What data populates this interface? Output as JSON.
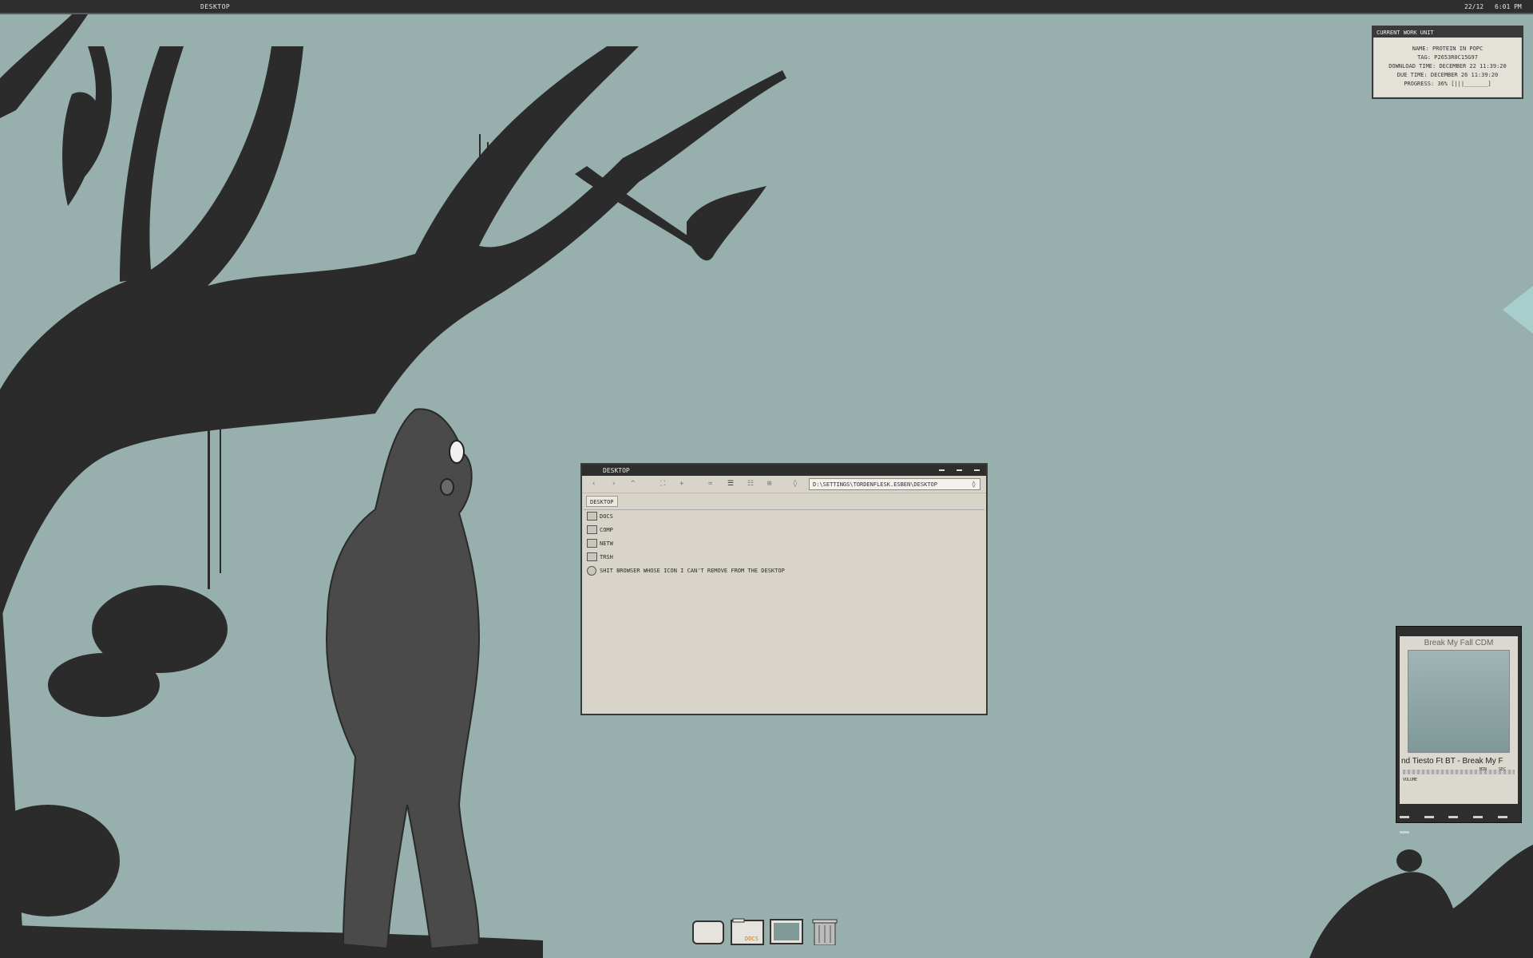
{
  "topbar": {
    "title": "DESKTOP",
    "date": "22/12",
    "time": "6:01 PM"
  },
  "workunit": {
    "title": "CURRENT WORK UNIT",
    "lines": [
      "NAME: PROTEIN IN POPC",
      "TAG: P2653R0C15G97",
      "DOWNLOAD TIME: DECEMBER 22 11:39:20",
      "DUE TIME: DECEMBER 26 11:39:20",
      "PROGRESS: 36% [|||_______]"
    ]
  },
  "filemanager": {
    "title": "DESKTOP",
    "path": "D:\\SETTINGS\\TORDENFLESK.ESBEN\\DESKTOP",
    "tab": "DESKTOP",
    "items": [
      {
        "label": "DOCS",
        "icon": "folder-icon"
      },
      {
        "label": "COMP",
        "icon": "computer-icon"
      },
      {
        "label": "NETW",
        "icon": "network-icon"
      },
      {
        "label": "TRSH",
        "icon": "trash-icon"
      },
      {
        "label": "SHIT BROWSER WHOSE ICON I CAN'T REMOVE FROM THE DESKTOP",
        "icon": "globe-icon"
      }
    ]
  },
  "player": {
    "track": "Break My Fall CDM",
    "scroll": "nd        Tiesto Ft BT - Break My F",
    "volume_label": "VOLUME",
    "min_label": "MIN",
    "sec_label": "SEC"
  },
  "dock": {
    "docs_label": "DOCS",
    "items": [
      "drive-icon",
      "docs-folder-icon",
      "monitor-icon",
      "trash-can-icon"
    ]
  }
}
